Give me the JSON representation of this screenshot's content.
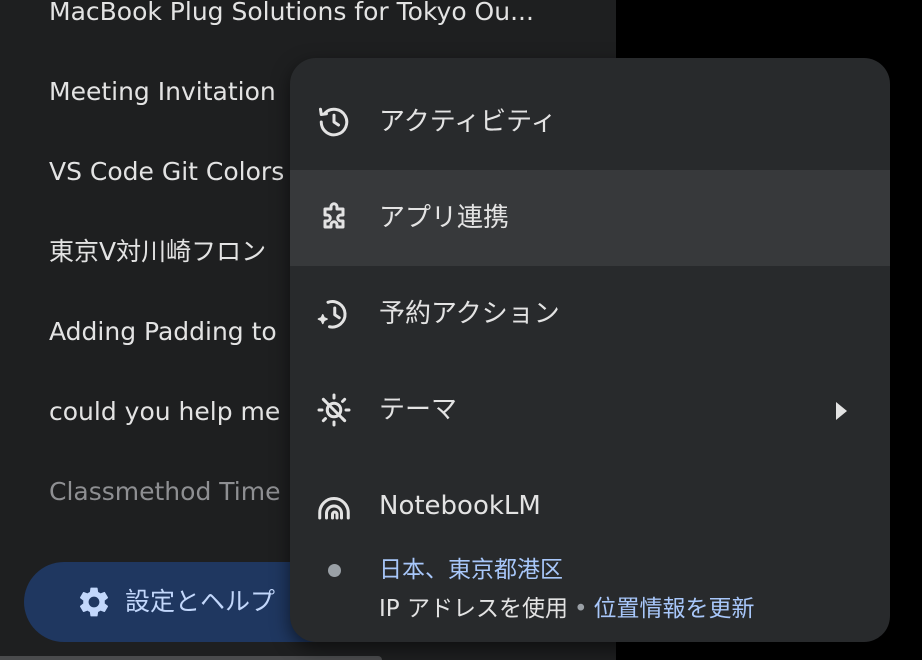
{
  "sidebar": {
    "recent_chats": [
      "MacBook Plug Solutions for Tokyo Ou...",
      "Meeting Invitation",
      "VS Code Git Colors",
      "東京V対川崎フロン",
      "Adding Padding to",
      "could you help me",
      "Classmethod Time"
    ],
    "settings_label": "設定とヘルプ",
    "settings_icon": "gear-icon"
  },
  "menu": {
    "items": [
      {
        "label": "アクティビティ",
        "icon": "history-icon"
      },
      {
        "label": "アプリ連携",
        "icon": "extension-icon",
        "highlighted": true
      },
      {
        "label": "予約アクション",
        "icon": "scheduled-actions-icon"
      },
      {
        "label": "テーマ",
        "icon": "theme-icon",
        "has_submenu": true
      },
      {
        "label": "NotebookLM",
        "icon": "notebooklm-icon"
      }
    ],
    "location": {
      "place": "日本、東京都港区",
      "source": "IP アドレスを使用",
      "separator": "•",
      "update_link": "位置情報を更新"
    }
  },
  "colors": {
    "sidebar_bg": "#1e1f20",
    "menu_bg": "#282a2c",
    "menu_highlight": "#37393b",
    "settings_pill": "#1f3760",
    "text": "#e3e3e3",
    "link": "#a8c7fa"
  }
}
